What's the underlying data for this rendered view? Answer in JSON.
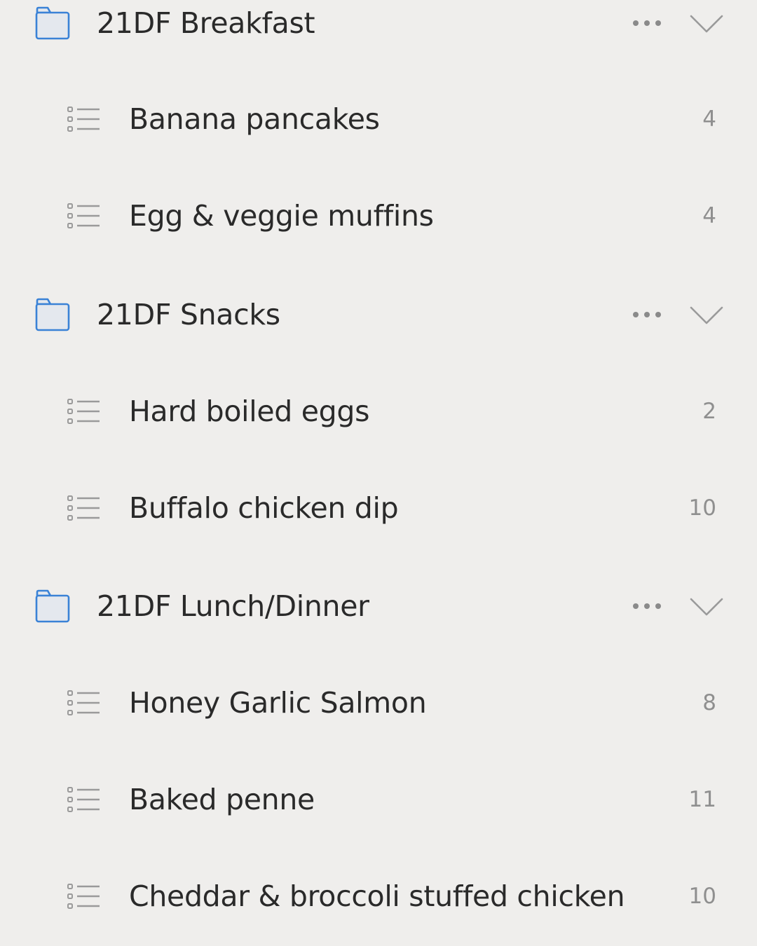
{
  "colors": {
    "background": "#efeeec",
    "folder_accent": "#3a82d6",
    "folder_fill": "#e4e8ee",
    "text": "#2a2a2a",
    "count_text": "#8f8f8f",
    "icon_gray": "#9a9a9a"
  },
  "groups": [
    {
      "title": "21DF Breakfast",
      "icon": "folder-icon",
      "items": [
        {
          "label": "Banana pancakes",
          "count": "4",
          "icon": "list-icon"
        },
        {
          "label": "Egg & veggie muffins",
          "count": "4",
          "icon": "list-icon"
        }
      ]
    },
    {
      "title": "21DF Snacks",
      "icon": "folder-icon",
      "items": [
        {
          "label": "Hard boiled eggs",
          "count": "2",
          "icon": "list-icon"
        },
        {
          "label": "Buffalo chicken dip",
          "count": "10",
          "icon": "list-icon"
        }
      ]
    },
    {
      "title": "21DF Lunch/Dinner",
      "icon": "folder-icon",
      "items": [
        {
          "label": "Honey Garlic Salmon",
          "count": "8",
          "icon": "list-icon"
        },
        {
          "label": "Baked penne",
          "count": "11",
          "icon": "list-icon"
        },
        {
          "label": "Cheddar & broccoli stuffed chicken",
          "count": "10",
          "icon": "list-icon"
        }
      ]
    }
  ]
}
